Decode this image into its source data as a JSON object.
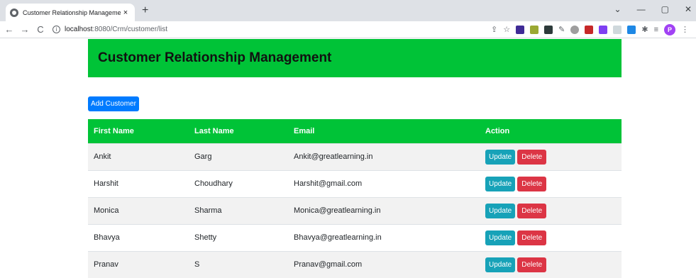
{
  "browser": {
    "tab_title": "Customer Relationship Managemen",
    "tab_close": "×",
    "new_tab": "+",
    "window_controls": {
      "minimize": "—",
      "restore": "▢",
      "close": "✕",
      "dropdown": "⌄"
    },
    "nav": {
      "back": "←",
      "forward": "→",
      "reload": "C"
    },
    "url_host": "localhost",
    "url_path": ":8080/Crm/customer/list",
    "profile_initial": "P",
    "extensions": [
      "share-icon",
      "star-icon",
      "extension-a",
      "extension-b",
      "extension-c",
      "extension-d",
      "extension-e",
      "extension-f",
      "extension-g",
      "extension-h",
      "extension-i",
      "puzzle-icon",
      "reading-list-icon"
    ]
  },
  "page": {
    "title": "Customer Relationship Management",
    "add_button": "Add Customer"
  },
  "table": {
    "headers": [
      "First Name",
      "Last Name",
      "Email",
      "Action"
    ],
    "update_label": "Update",
    "delete_label": "Delete",
    "rows": [
      {
        "first": "Ankit",
        "last": "Garg",
        "email": "Ankit@greatlearning.in"
      },
      {
        "first": "Harshit",
        "last": "Choudhary",
        "email": "Harshit@gmail.com"
      },
      {
        "first": "Monica",
        "last": "Sharma",
        "email": "Monica@greatlearning.in"
      },
      {
        "first": "Bhavya",
        "last": "Shetty",
        "email": "Bhavya@greatlearning.in"
      },
      {
        "first": "Pranav",
        "last": "S",
        "email": "Pranav@gmail.com"
      }
    ]
  },
  "colors": {
    "header_green": "#00c337",
    "primary": "#007bff",
    "info": "#17a2b8",
    "danger": "#dc3545"
  }
}
